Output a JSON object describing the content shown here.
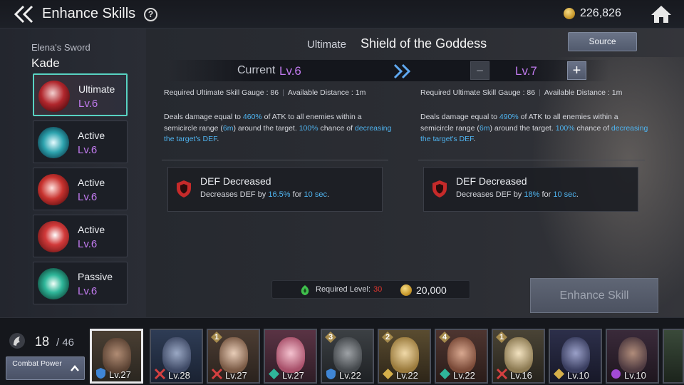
{
  "header": {
    "title": "Enhance Skills",
    "help": "?",
    "gold": "226,826",
    "back_icon": "back-arrow-icon",
    "home_icon": "home-icon"
  },
  "sidebar": {
    "weapon": "Elena's Sword",
    "hero": "Kade",
    "skills": [
      {
        "type": "Ultimate",
        "level": "Lv.6",
        "selected": true
      },
      {
        "type": "Active",
        "level": "Lv.6"
      },
      {
        "type": "Active",
        "level": "Lv.6"
      },
      {
        "type": "Active",
        "level": "Lv.6"
      },
      {
        "type": "Passive",
        "level": "Lv.6"
      }
    ]
  },
  "skill": {
    "category": "Ultimate",
    "name": "Shield of the Goddess",
    "source_label": "Source",
    "current_label": "Current",
    "current_level": "Lv.6",
    "minus": "−",
    "next_level": "Lv.7",
    "plus": "+"
  },
  "current": {
    "gauge": "Required Ultimate Skill Gauge : 86",
    "distance": "Available Distance : 1m",
    "desc_1": "Deals damage equal to ",
    "pct": "460%",
    "desc_2": " of ATK to all enemies within a semicircle range (",
    "range": "6m",
    "desc_3": ") around the target. ",
    "chance": "100%",
    "desc_4": " chance of ",
    "effect_link": "decreasing the target's DEF",
    "desc_5": ".",
    "effect_title": "DEF Decreased",
    "effect_1": "Decreases DEF by ",
    "effect_pct": "16.5%",
    "effect_2": " for ",
    "effect_dur": "10 sec",
    "effect_3": "."
  },
  "next": {
    "gauge": "Required Ultimate Skill Gauge : 86",
    "distance": "Available Distance : 1m",
    "desc_1": "Deals damage equal to ",
    "pct": "490%",
    "desc_2": " of ATK to all enemies within a semicircle range (",
    "range": "6m",
    "desc_3": ") around the target. ",
    "chance": "100%",
    "desc_4": " chance of ",
    "effect_link": "decreasing the target's DEF",
    "desc_5": ".",
    "effect_title": "DEF Decreased",
    "effect_1": "Decreases DEF by ",
    "effect_pct": "18%",
    "effect_2": " for ",
    "effect_dur": "10 sec",
    "effect_3": "."
  },
  "cost": {
    "req_level_label": "Required Level:",
    "req_level": "30",
    "gold": "20,000",
    "enhance_label": "Enhance Skill"
  },
  "roster": {
    "count": "18",
    "max": "/ 46",
    "combat_label": "Combat Power",
    "heroes": [
      {
        "level": "Lv.27",
        "class": "defender",
        "selected": true
      },
      {
        "level": "Lv.28",
        "class": "attacker"
      },
      {
        "level": "Lv.27",
        "class": "attacker",
        "rank": "1"
      },
      {
        "level": "Lv.27",
        "class": "supporter"
      },
      {
        "level": "Lv.22",
        "class": "defender",
        "rank": "3"
      },
      {
        "level": "Lv.22",
        "class": "support-gold",
        "rank": "2"
      },
      {
        "level": "Lv.22",
        "class": "supporter",
        "rank": "4"
      },
      {
        "level": "Lv.16",
        "class": "attacker",
        "rank": "1"
      },
      {
        "level": "Lv.10",
        "class": "support-gold"
      },
      {
        "level": "Lv.10",
        "class": "magic"
      }
    ]
  },
  "colors": {
    "accent_purple": "#c27bf0",
    "highlight_blue": "#4fb4f0",
    "required_red": "#e2362e",
    "selection_teal": "#58d2c2"
  }
}
